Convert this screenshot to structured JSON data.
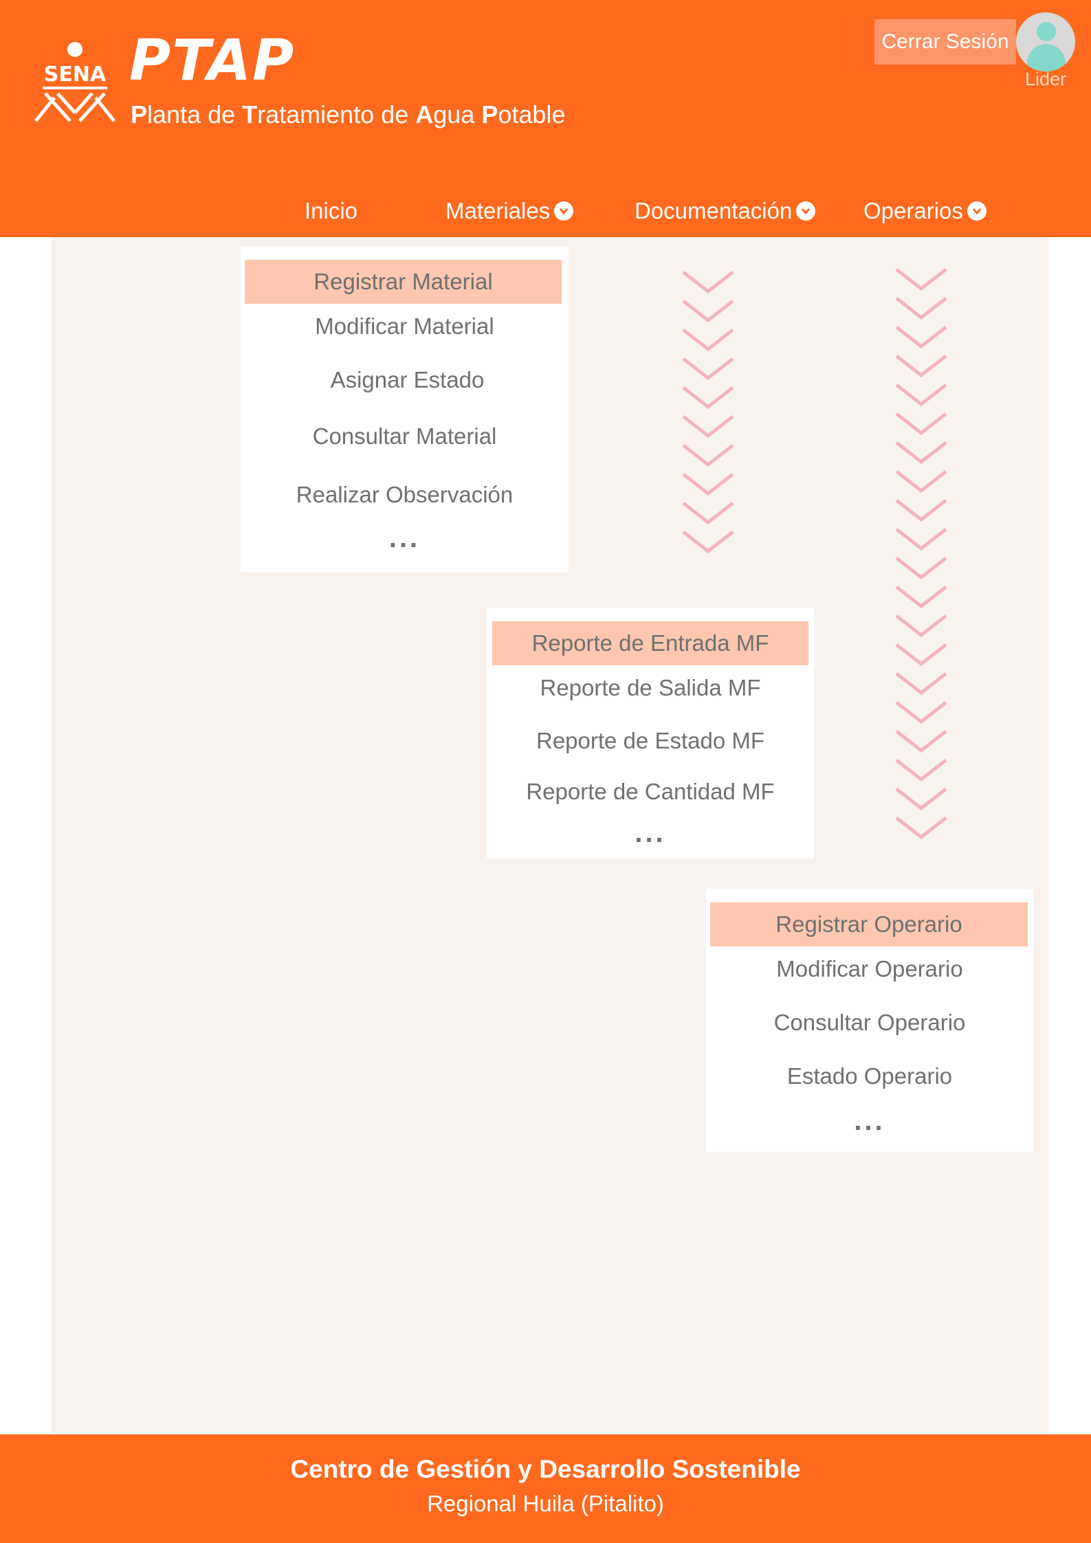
{
  "header": {
    "logo_text": "SENA",
    "app_name": "PTAP",
    "subtitle_parts": [
      {
        "cap": "P",
        "rest": "lanta de "
      },
      {
        "cap": "T",
        "rest": "ratamiento de "
      },
      {
        "cap": "A",
        "rest": "gua "
      },
      {
        "cap": "P",
        "rest": "otable"
      }
    ],
    "logout_label": "Cerrar Sesión",
    "user_role": "Lider"
  },
  "nav": {
    "items": [
      {
        "label": "Inicio",
        "icon": "none"
      },
      {
        "label": "Materiales",
        "icon": "chevron-down-icon"
      },
      {
        "label": "Documentación",
        "icon": "chevron-down-icon"
      },
      {
        "label": "Operarios",
        "icon": "chevron-down-icon"
      }
    ]
  },
  "menus": {
    "materiales": {
      "items": [
        "Registrar Material",
        "Modificar Material",
        "Asignar Estado",
        "Consultar Material",
        "Realizar Observación"
      ],
      "more": "..."
    },
    "documentacion": {
      "items": [
        "Reporte de Entrada MF",
        "Reporte de Salida MF",
        "Reporte de Estado MF",
        "Reporte de Cantidad MF"
      ],
      "more": "..."
    },
    "operarios": {
      "items": [
        "Registrar Operario",
        "Modificar Operario",
        "Consultar Operario",
        "Estado Operario"
      ],
      "more": "..."
    }
  },
  "footer": {
    "title": "Centro de Gestión y Desarrollo Sostenible",
    "subtitle": "Regional Huila (Pitalito)"
  },
  "colors": {
    "brand_orange": "#ff6a1e",
    "highlight_peach": "#ffc7ad",
    "content_bg": "#f8f3ef",
    "chevron_pink": "#f4b3bc",
    "menu_text": "#707070"
  }
}
